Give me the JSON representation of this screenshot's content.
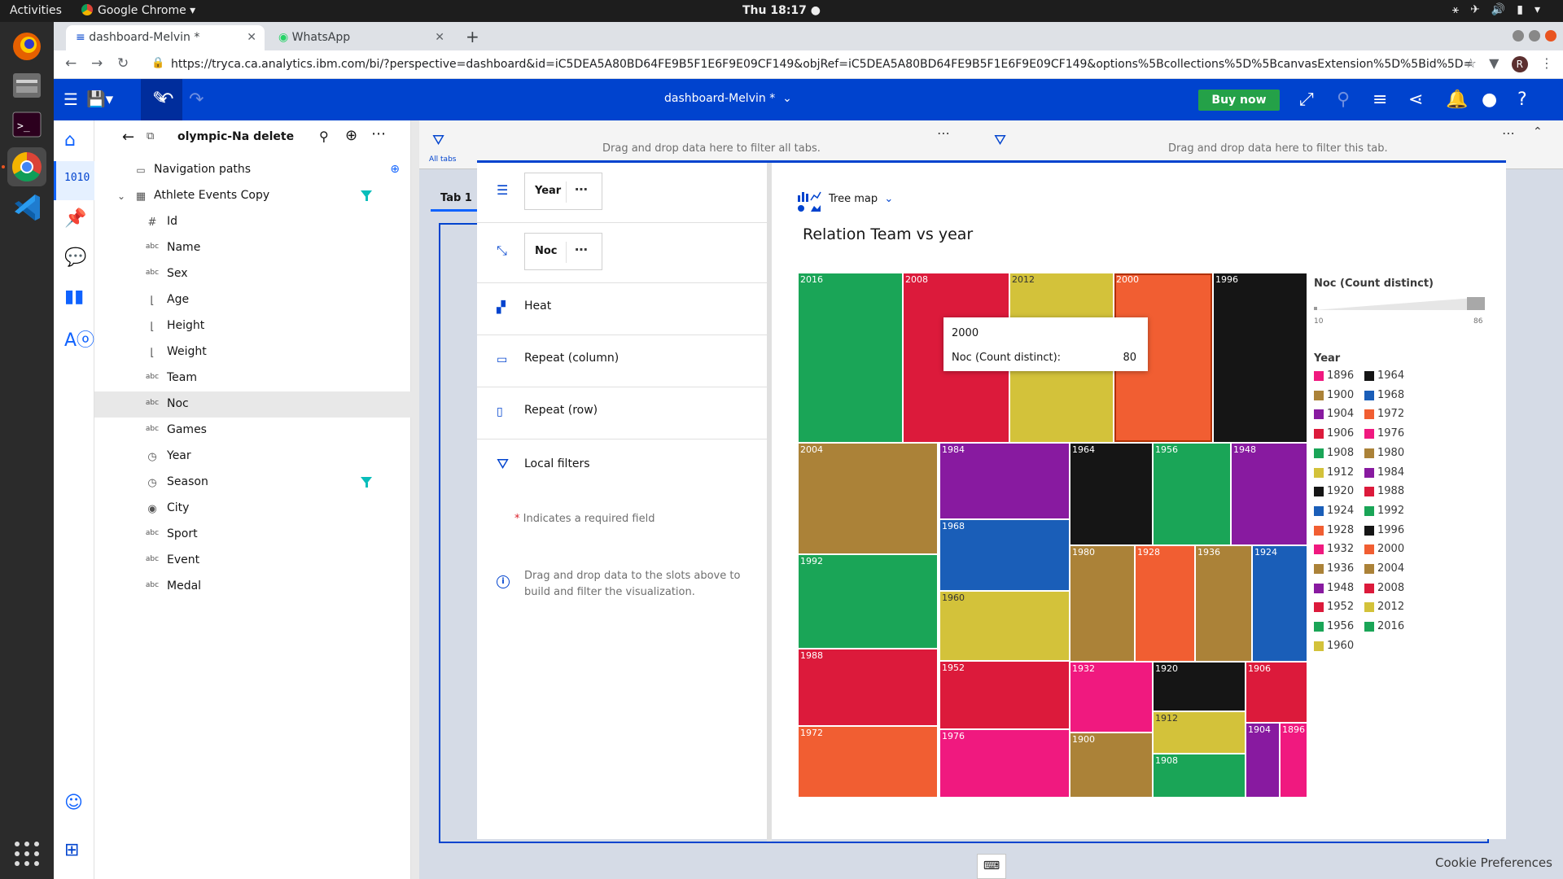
{
  "system": {
    "activities": "Activities",
    "app_name": "Google Chrome",
    "clock": "Thu 18:17 ●"
  },
  "browser": {
    "tabs": [
      {
        "label": "dashboard-Melvin *"
      },
      {
        "label": "WhatsApp"
      }
    ],
    "url": "https://tryca.ca.analytics.ibm.com/bi/?perspective=dashboard&id=iC5DEA5A80BD64FE9B5F1E6F9E09CF149&objRef=iC5DEA5A80BD64FE9B5F1E6F9E09CF149&options%5Bcollections%5D%5BcanvasExtension%5D%5Bid%5D=com.ibm.bi.da...",
    "profile_initial": "R"
  },
  "appbar": {
    "title": "dashboard-Melvin *",
    "buy_label": "Buy now"
  },
  "datasource": {
    "title": "olympic-Na delete",
    "nav_paths": "Navigation paths",
    "table": "Athlete Events Copy",
    "fields": [
      {
        "icon": "#",
        "name": "Id"
      },
      {
        "icon": "abc",
        "name": "Name"
      },
      {
        "icon": "abc",
        "name": "Sex"
      },
      {
        "icon": "ruler",
        "name": "Age"
      },
      {
        "icon": "ruler",
        "name": "Height"
      },
      {
        "icon": "ruler",
        "name": "Weight"
      },
      {
        "icon": "abc",
        "name": "Team"
      },
      {
        "icon": "abc",
        "name": "Noc"
      },
      {
        "icon": "abc",
        "name": "Games"
      },
      {
        "icon": "clock",
        "name": "Year"
      },
      {
        "icon": "clock",
        "name": "Season"
      },
      {
        "icon": "pin",
        "name": "City"
      },
      {
        "icon": "abc",
        "name": "Sport"
      },
      {
        "icon": "abc",
        "name": "Event"
      },
      {
        "icon": "abc",
        "name": "Medal"
      }
    ]
  },
  "canvas": {
    "all_tabs_label": "All tabs",
    "filter_all_hint": "Drag and drop data here to filter all tabs.",
    "filter_tab_hint": "Drag and drop data here to filter this tab.",
    "tab_label": "Tab 1",
    "cookie": "Cookie Preferences"
  },
  "viz": {
    "slots": {
      "year": "Year",
      "noc": "Noc",
      "heat": "Heat",
      "repeat_col": "Repeat (column)",
      "repeat_row": "Repeat (row)",
      "local_filters": "Local filters",
      "required_star": "*",
      "required_note": "Indicates a required field",
      "hint": "Drag and drop data to the slots above to build and filter the visualization."
    },
    "type_label": "Tree map",
    "tooltip": {
      "year": "2000",
      "measure_label": "Noc (Count distinct):",
      "measure_value": "80"
    }
  },
  "chart_data": {
    "type": "treemap",
    "title": "Relation Team vs year",
    "measure": "Noc (Count distinct)",
    "color_scale": {
      "min": 10,
      "max": 86
    },
    "legend_title": "Year",
    "cells": [
      {
        "label": "2016",
        "color": "#1aa557"
      },
      {
        "label": "2008",
        "color": "#dc1a3b"
      },
      {
        "label": "2012",
        "color": "#d3c23a"
      },
      {
        "label": "2000",
        "color": "#f15e32",
        "value": 80
      },
      {
        "label": "1996",
        "color": "#151515"
      },
      {
        "label": "2004",
        "color": "#ab8238"
      },
      {
        "label": "1984",
        "color": "#881aa0"
      },
      {
        "label": "1968",
        "color": "#1a5eb8"
      },
      {
        "label": "1964",
        "color": "#151515"
      },
      {
        "label": "1956",
        "color": "#1aa557"
      },
      {
        "label": "1948",
        "color": "#881aa0"
      },
      {
        "label": "1992",
        "color": "#1aa557"
      },
      {
        "label": "1960",
        "color": "#d3c23a"
      },
      {
        "label": "1980",
        "color": "#ab8238"
      },
      {
        "label": "1928",
        "color": "#f15e32"
      },
      {
        "label": "1936",
        "color": "#ab8238"
      },
      {
        "label": "1924",
        "color": "#1a5eb8"
      },
      {
        "label": "1988",
        "color": "#dc1a3b"
      },
      {
        "label": "1952",
        "color": "#dc1a3b"
      },
      {
        "label": "1932",
        "color": "#f0197f"
      },
      {
        "label": "1920",
        "color": "#151515"
      },
      {
        "label": "1906",
        "color": "#dc1a3b"
      },
      {
        "label": "1912",
        "color": "#d3c23a"
      },
      {
        "label": "1972",
        "color": "#f15e32"
      },
      {
        "label": "1976",
        "color": "#f0197f"
      },
      {
        "label": "1900",
        "color": "#ab8238"
      },
      {
        "label": "1908",
        "color": "#1aa557"
      },
      {
        "label": "1904",
        "color": "#881aa0"
      },
      {
        "label": "1896",
        "color": "#f0197f"
      }
    ],
    "legend": [
      {
        "label": "1896",
        "color": "#f0197f"
      },
      {
        "label": "1900",
        "color": "#ab8238"
      },
      {
        "label": "1904",
        "color": "#881aa0"
      },
      {
        "label": "1906",
        "color": "#dc1a3b"
      },
      {
        "label": "1908",
        "color": "#1aa557"
      },
      {
        "label": "1912",
        "color": "#d3c23a"
      },
      {
        "label": "1920",
        "color": "#151515"
      },
      {
        "label": "1924",
        "color": "#1a5eb8"
      },
      {
        "label": "1928",
        "color": "#f15e32"
      },
      {
        "label": "1932",
        "color": "#f0197f"
      },
      {
        "label": "1936",
        "color": "#ab8238"
      },
      {
        "label": "1948",
        "color": "#881aa0"
      },
      {
        "label": "1952",
        "color": "#dc1a3b"
      },
      {
        "label": "1956",
        "color": "#1aa557"
      },
      {
        "label": "1960",
        "color": "#d3c23a"
      },
      {
        "label": "1964",
        "color": "#151515"
      },
      {
        "label": "1968",
        "color": "#1a5eb8"
      },
      {
        "label": "1972",
        "color": "#f15e32"
      },
      {
        "label": "1976",
        "color": "#f0197f"
      },
      {
        "label": "1980",
        "color": "#ab8238"
      },
      {
        "label": "1984",
        "color": "#881aa0"
      },
      {
        "label": "1988",
        "color": "#dc1a3b"
      },
      {
        "label": "1992",
        "color": "#1aa557"
      },
      {
        "label": "1996",
        "color": "#151515"
      },
      {
        "label": "2000",
        "color": "#f15e32"
      },
      {
        "label": "2004",
        "color": "#ab8238"
      },
      {
        "label": "2008",
        "color": "#dc1a3b"
      },
      {
        "label": "2012",
        "color": "#d3c23a"
      },
      {
        "label": "2016",
        "color": "#1aa557"
      }
    ]
  }
}
